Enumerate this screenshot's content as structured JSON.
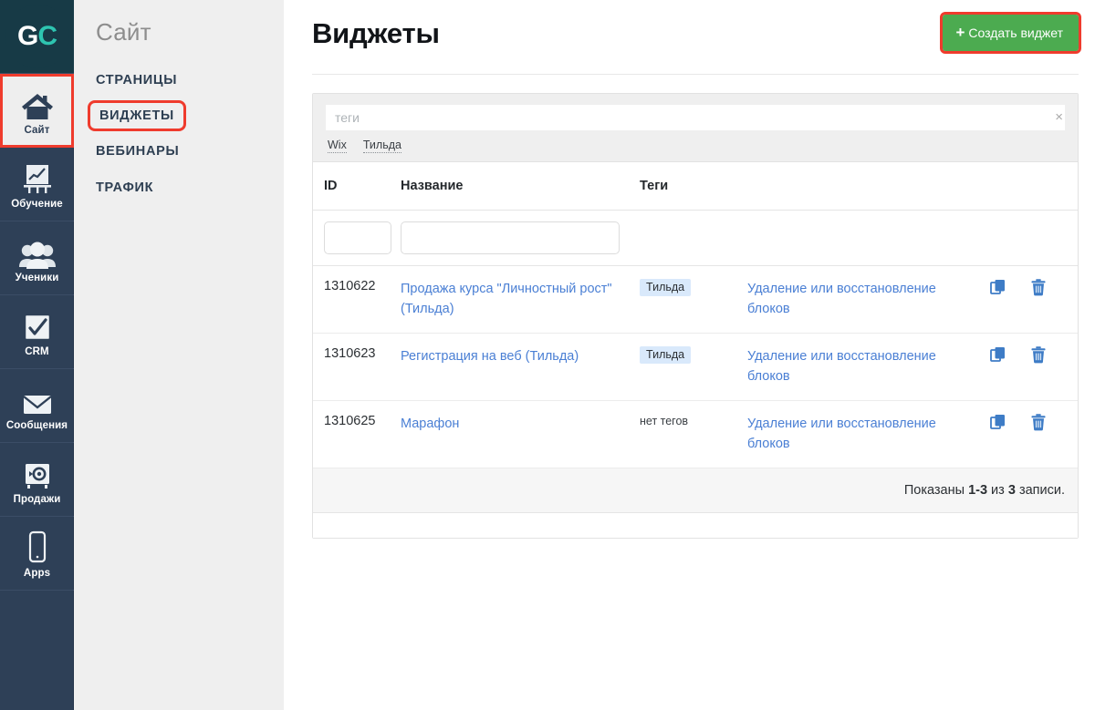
{
  "brand": {
    "logo_text_left": "G",
    "logo_text_right": "C",
    "logo_name": "GC"
  },
  "rail": {
    "items": [
      {
        "label": "Сайт",
        "icon": "house-icon",
        "active": true
      },
      {
        "label": "Обучение",
        "icon": "chart-easel-icon",
        "active": false
      },
      {
        "label": "Ученики",
        "icon": "users-icon",
        "active": false
      },
      {
        "label": "CRM",
        "icon": "checkbox-icon",
        "active": false
      },
      {
        "label": "Сообщения",
        "icon": "envelope-icon",
        "active": false
      },
      {
        "label": "Продажи",
        "icon": "safe-icon",
        "active": false
      },
      {
        "label": "Apps",
        "icon": "phone-icon",
        "active": false
      }
    ]
  },
  "subnav": {
    "title": "Сайт",
    "items": [
      {
        "label": "СТРАНИЦЫ",
        "marked": false
      },
      {
        "label": "ВИДЖЕТЫ",
        "marked": true
      },
      {
        "label": "ВЕБИНАРЫ",
        "marked": false
      },
      {
        "label": "ТРАФИК",
        "marked": false
      }
    ]
  },
  "header": {
    "title": "Виджеты",
    "create_button": "Создать виджет",
    "create_button_plus": "+"
  },
  "filter": {
    "tags_placeholder": "теги",
    "tags_value": "",
    "clear_icon": "×",
    "suggestions": [
      "Wix",
      "Тильда"
    ]
  },
  "table": {
    "columns": [
      "ID",
      "Название",
      "Теги",
      "",
      ""
    ],
    "filter_row": {
      "id_value": "",
      "name_value": ""
    },
    "rows": [
      {
        "id": "1310622",
        "name": "Продажа курса \"Личностный рост\" (Тильда)",
        "tag": "Тильда",
        "has_tag": true,
        "description": "Удаление или восстановление блоков",
        "copy_icon": "copy-icon",
        "delete_icon": "trash-icon"
      },
      {
        "id": "1310623",
        "name": "Регистрация на веб (Тильда)",
        "tag": "Тильда",
        "has_tag": true,
        "description": "Удаление или восстановление блоков",
        "copy_icon": "copy-icon",
        "delete_icon": "trash-icon"
      },
      {
        "id": "1310625",
        "name": "Марафон",
        "tag": "нет тегов",
        "has_tag": false,
        "description": "Удаление или восстановление блоков",
        "copy_icon": "copy-icon",
        "delete_icon": "trash-icon"
      }
    ],
    "footer": {
      "prefix": "Показаны ",
      "range": "1-3",
      "middle": " из ",
      "total": "3",
      "suffix": " записи."
    }
  },
  "colors": {
    "rail_bg": "#2e4057",
    "logo_bg": "#173a46",
    "logo_accent": "#2ec4b0",
    "subnav_bg": "#efefef",
    "accent_green": "#4cab50",
    "highlight_red": "#ef3b2d",
    "link_blue": "#4a7fd4",
    "tag_chip_bg": "#d9e9fb"
  }
}
